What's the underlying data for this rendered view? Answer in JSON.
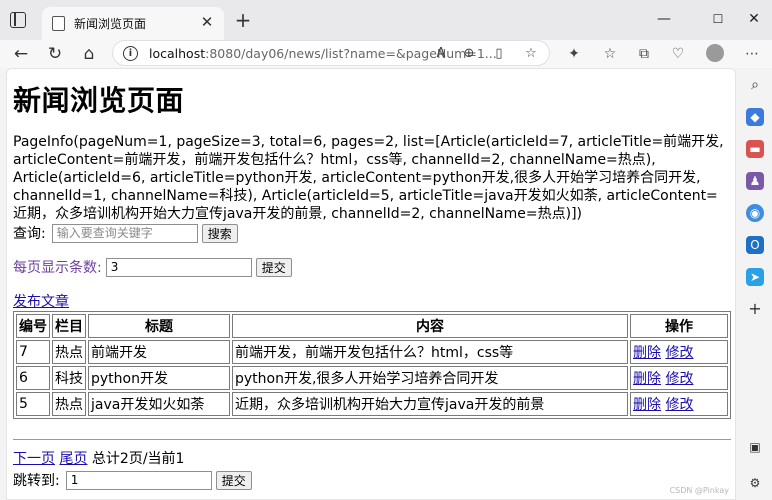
{
  "browser": {
    "tab_title": "新闻浏览页面",
    "new_tab_symbol": "+",
    "close_symbol": "✕",
    "url_host": "localhost",
    "url_path": ":8080/day06/news/list?name=&pageNum=1...",
    "window_controls": [
      "—",
      "☐",
      "✕"
    ]
  },
  "page": {
    "heading": "新闻浏览页面",
    "pageinfo": "PageInfo(pageNum=1, pageSize=3, total=6, pages=2, list=[Article(articleId=7, articleTitle=前端开发, articleContent=前端开发，前端开发包括什么？html，css等, channelId=2, channelName=热点), Article(articleId=6, articleTitle=python开发, articleContent=python开发,很多人开始学习培养合同开发, channelId=1, channelName=科技), Article(articleId=5, articleTitle=java开发如火如荼, articleContent=近期，众多培训机构开始大力宣传java开发的前景, channelId=2, channelName=热点)])",
    "search": {
      "label": "查询:",
      "placeholder": "输入要查询关键字",
      "button": "搜索"
    },
    "page_size": {
      "label": "每页显示条数:",
      "value": "3",
      "button": "提交"
    },
    "publish_link": "发布文章",
    "table": {
      "headers": [
        "编号",
        "栏目",
        "标题",
        "内容",
        "操作"
      ],
      "rows": [
        {
          "id": "7",
          "channel": "热点",
          "title": "前端开发",
          "content": "前端开发，前端开发包括什么？html，css等",
          "delete": "删除",
          "edit": "修改"
        },
        {
          "id": "6",
          "channel": "科技",
          "title": "python开发",
          "content": "python开发,很多人开始学习培养合同开发",
          "delete": "删除",
          "edit": "修改"
        },
        {
          "id": "5",
          "channel": "热点",
          "title": "java开发如火如荼",
          "content": "近期，众多培训机构开始大力宣传java开发的前景",
          "delete": "删除",
          "edit": "修改"
        }
      ]
    },
    "pager": {
      "next": "下一页",
      "last": "尾页",
      "summary": "总计2页/当前1",
      "jump_label": "跳转到:",
      "jump_value": "1",
      "jump_button": "提交"
    }
  },
  "watermark": "CSDN @Pinkay",
  "colors": {
    "link": "#1a0dab",
    "purple_label": "#6f3fa0"
  }
}
